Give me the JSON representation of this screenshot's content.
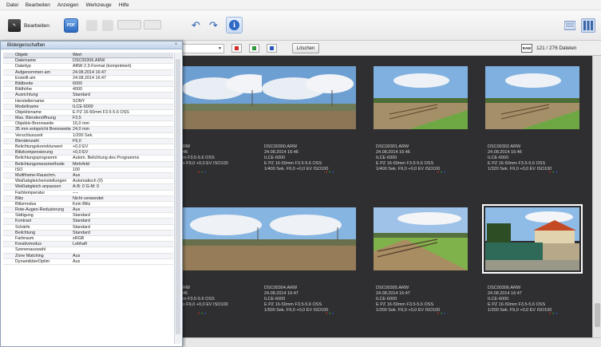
{
  "menu": [
    "Datei",
    "Bearbeiten",
    "Anzeigen",
    "Werkzeuge",
    "Hilfe"
  ],
  "toolbar": {
    "edit_label": "Bearbeiten",
    "pdf_icon_text": "PDF"
  },
  "filter": {
    "clear_label": "Löschen",
    "raw_badge": "RAW",
    "count": "121 / 276 Dateien"
  },
  "panel": {
    "title": "Bildeigenschaften",
    "header": [
      "Objekt",
      "Wert"
    ],
    "rows": [
      [
        "Dateiname",
        "DSC00306.ARW"
      ],
      [
        "Dateityp",
        "ARW 2.3-Format (komprimiert)"
      ],
      [
        "Aufgenommen am",
        "24.08.2014 16:47"
      ],
      [
        "Erstellt am",
        "24.08.2014 16:47"
      ],
      [
        "Bildbreite",
        "6000"
      ],
      [
        "Bildhöhe",
        "4000"
      ],
      [
        "Ausrichtung",
        "Standard"
      ],
      [
        "Herstellername",
        "SONY"
      ],
      [
        "Modellname",
        "ILCE-6000"
      ],
      [
        "Objektivname",
        "E PZ 16-50mm F3.5-5.6 OSS"
      ],
      [
        "Max. Blendenöffnung",
        "F3,5"
      ],
      [
        "Objektiv-Brennweite",
        "16,0 mm"
      ],
      [
        "35 mm entspricht Brennweite",
        "24,0 mm"
      ],
      [
        "Verschlusszeit",
        "1/200 Sek."
      ],
      [
        "Blendenzahl",
        "F9,0"
      ],
      [
        "Belichtungskorrekturwert",
        "+0,0 EV"
      ],
      [
        "Blitzkompensierung",
        "+0,0 EV"
      ],
      [
        "Belichtungsprogramm",
        "Autom. Belichtung des Programms"
      ],
      [
        "Belichtungsmessmethode",
        "Mehrfeld"
      ],
      [
        "ISO",
        "100"
      ],
      [
        "Multiframe-Rauschm.",
        "Aus"
      ],
      [
        "Weißabgleicheinstellungen",
        "Automatisch (0)"
      ],
      [
        "Weißabgleich anpassen",
        "A-B: 0 G-M: 0"
      ],
      [
        "Farbtemperatur",
        "----"
      ],
      [
        "Blitz",
        "Nicht verwendet"
      ],
      [
        "Blitzmodus",
        "Kein Blitz"
      ],
      [
        "Rote-Augen-Reduzierung",
        "Aus"
      ],
      [
        "Sättigung",
        "Standard"
      ],
      [
        "Kontrast",
        "Standard"
      ],
      [
        "Schärfe",
        "Standard"
      ],
      [
        "Belichtung",
        "Standard"
      ],
      [
        "Farbraum",
        "sRGB"
      ],
      [
        "Kreativmodus",
        "Lebhaft"
      ],
      [
        "Szenenauswahl",
        ""
      ],
      [
        "Zone Matching",
        "Aus"
      ],
      [
        "DynamikberOptim",
        "Aus"
      ]
    ]
  },
  "thumbnails": [
    {
      "name": "RW",
      "date": "46",
      "model": "",
      "lens": "m F3.5-5.6 OSS",
      "exposure": "x F9,0 +0,0 EV ISO100",
      "scene": "wide-sky"
    },
    {
      "name": "DSC00300.ARW",
      "date": "24.08.2014 16:46",
      "model": "ILCE-6000",
      "lens": "E PZ 16-50mm F3.5-5.6 OSS",
      "exposure": "1/400 Sek. F9,0 +0,0 EV ISO100",
      "scene": "wide-sky"
    },
    {
      "name": "DSC00301.ARW",
      "date": "24.08.2014 16:46",
      "model": "ILCE-6000",
      "lens": "E PZ 16-50mm F3.5-5.6 OSS",
      "exposure": "1/400 Sek. F9,0 +0,0 EV ISO100",
      "scene": "fence-field"
    },
    {
      "name": "DSC00302.ARW",
      "date": "24.08.2014 16:46",
      "model": "ILCE-6000",
      "lens": "E PZ 16-50mm F3.5-5.6 OSS",
      "exposure": "1/320 Sek. F9,0 +0,0 EV ISO100",
      "scene": "fence-field"
    },
    {
      "name": "RW",
      "date": "46",
      "model": "",
      "lens": "m F3.5-5.6 OSS",
      "exposure": "x F9,0 +0,0 EV ISO100",
      "scene": "field"
    },
    {
      "name": "DSC00304.ARW",
      "date": "24.08.2014 16:47",
      "model": "ILCE-6000",
      "lens": "E PZ 16-50mm F3.5-5.6 OSS",
      "exposure": "1/500 Sek. F9,0 +0,0 EV ISO100",
      "scene": "field"
    },
    {
      "name": "DSC00305.ARW",
      "date": "24.08.2014 16:47",
      "model": "ILCE-6000",
      "lens": "E PZ 16-50mm F3.5-5.6 OSS",
      "exposure": "1/200 Sek. F9,0 +0,0 EV ISO100",
      "scene": "fence-path"
    },
    {
      "name": "DSC00306.ARW",
      "date": "24.08.2014 16:47",
      "model": "ILCE-6000",
      "lens": "E PZ 16-50mm F3.5-5.6 OSS",
      "exposure": "1/200 Sek. F9,0 +0,0 EV ISO100",
      "scene": "house"
    }
  ],
  "colors": {
    "grid_bg": "#2f2f31",
    "accent": "#2d69c5",
    "flag_red": "#d42a2a",
    "flag_green": "#2d9a3a",
    "flag_blue": "#2c55c4"
  }
}
